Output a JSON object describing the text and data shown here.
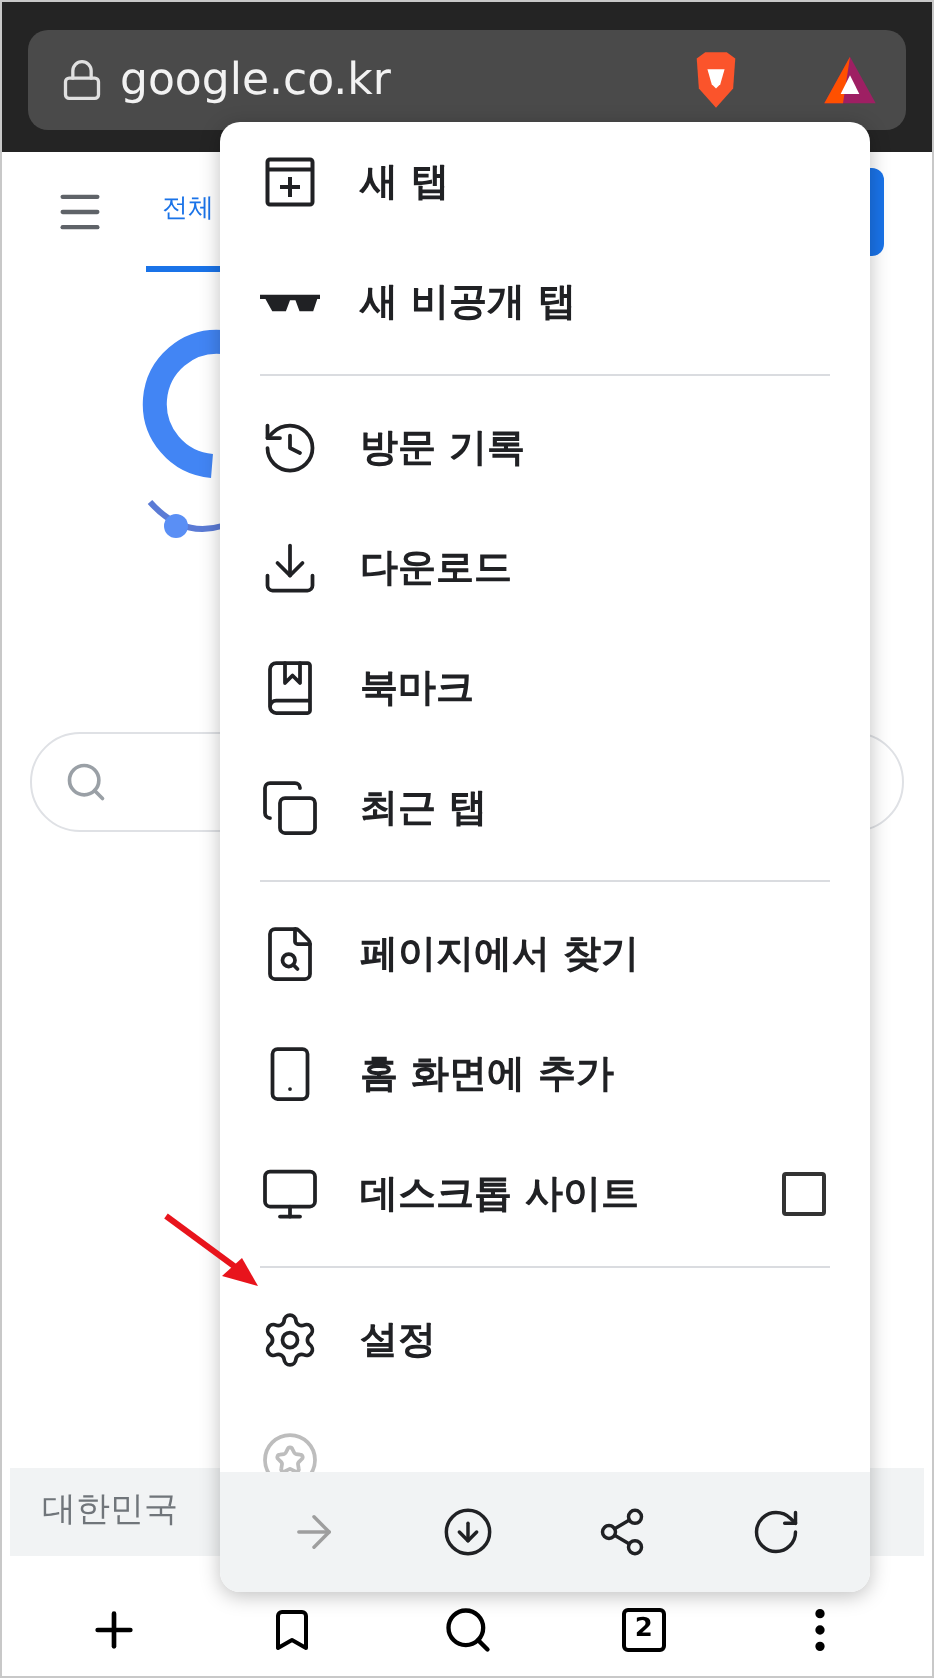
{
  "address_bar": {
    "url": "google.co.kr"
  },
  "page": {
    "tabs": [
      {
        "label": "전체",
        "selected": true
      }
    ],
    "footer": {
      "region": "대한민국"
    }
  },
  "menu": {
    "items": [
      {
        "kind": "item",
        "label": "새 탭",
        "disabled": false
      },
      {
        "kind": "item",
        "label": "새 비공개 탭",
        "disabled": false
      },
      {
        "kind": "divider"
      },
      {
        "kind": "item",
        "label": "방문 기록",
        "disabled": false
      },
      {
        "kind": "item",
        "label": "다운로드",
        "disabled": false
      },
      {
        "kind": "item",
        "label": "북마크",
        "disabled": false
      },
      {
        "kind": "item",
        "label": "최근 탭",
        "disabled": false
      },
      {
        "kind": "divider"
      },
      {
        "kind": "item",
        "label": "페이지에서 찾기",
        "disabled": false
      },
      {
        "kind": "item",
        "label": "홈 화면에 추가",
        "disabled": false
      },
      {
        "kind": "checkbox",
        "label": "데스크톱 사이트",
        "checked": false,
        "disabled": false
      },
      {
        "kind": "divider"
      },
      {
        "kind": "item",
        "label": "설정",
        "disabled": false
      },
      {
        "kind": "partial",
        "disabled": true
      }
    ],
    "actions": [
      {
        "disabled": true
      },
      {
        "disabled": false
      },
      {
        "disabled": false
      },
      {
        "disabled": false
      }
    ]
  },
  "bottom_nav": {
    "tab_count": "2"
  }
}
